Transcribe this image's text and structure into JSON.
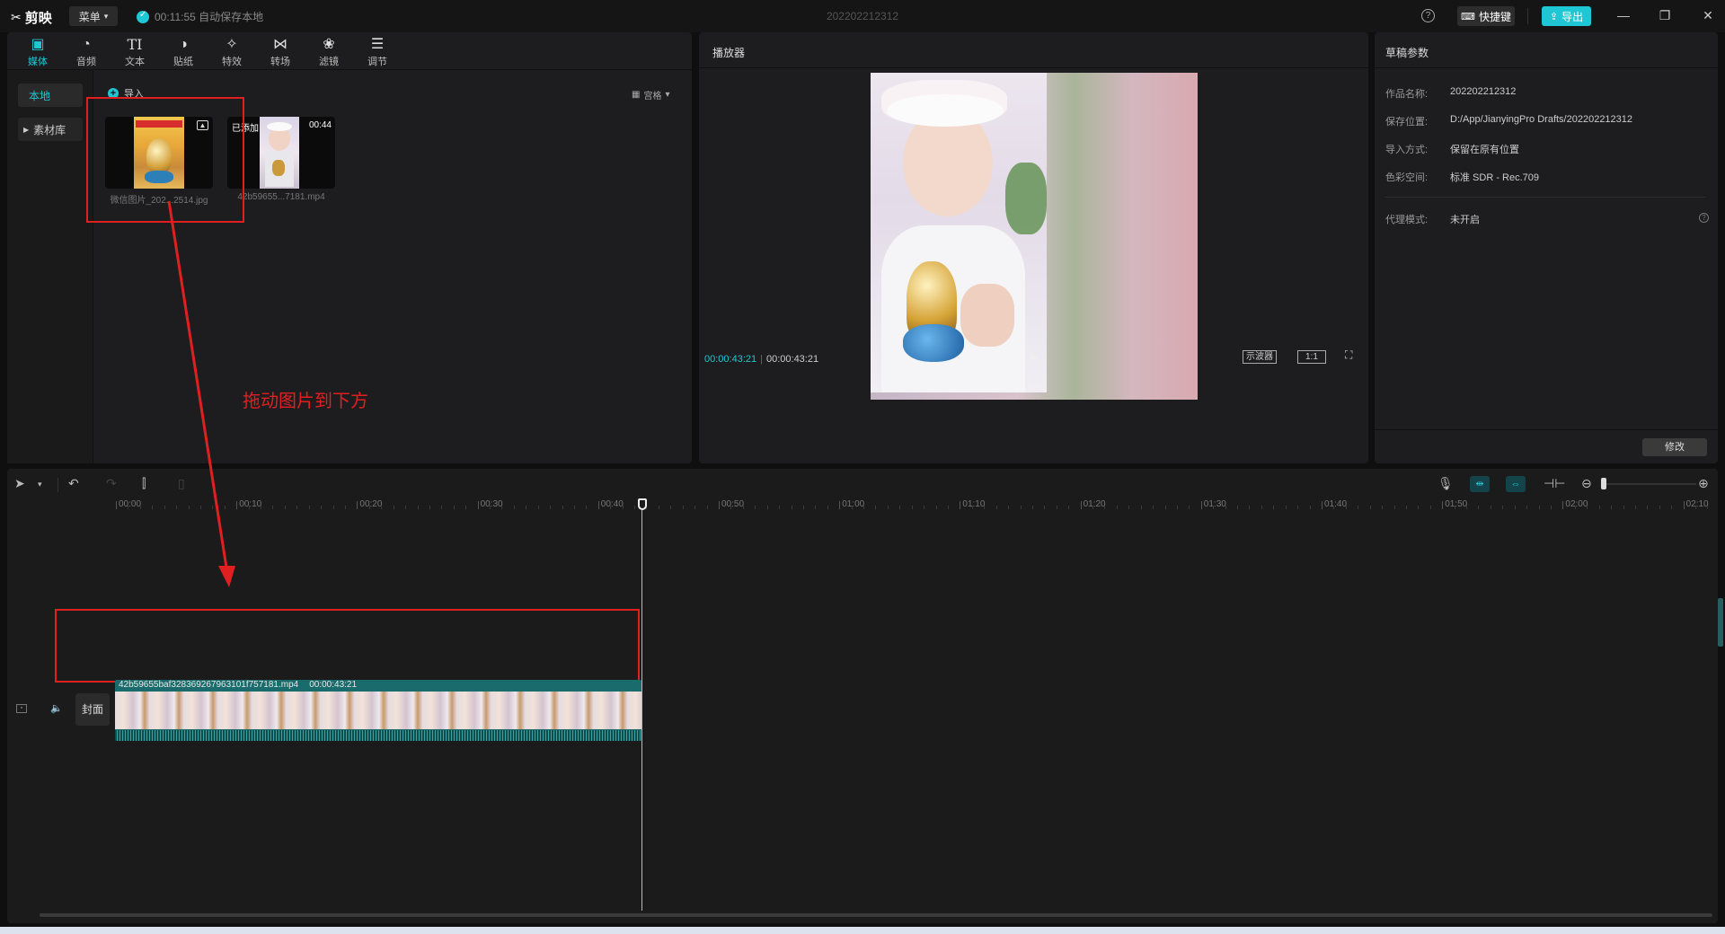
{
  "titlebar": {
    "app_name": "剪映",
    "menu_label": "菜单",
    "autosave": "00:11:55 自动保存本地",
    "doc_title": "202202212312",
    "shortcut_label": "快捷键",
    "export_label": "导出"
  },
  "media_toolbar": {
    "tools": [
      "媒体",
      "音频",
      "文本",
      "贴纸",
      "特效",
      "转场",
      "滤镜",
      "调节"
    ]
  },
  "media_panel": {
    "side_tabs": [
      "本地",
      "素材库"
    ],
    "import_label": "导入",
    "view_label": "宫格",
    "items": [
      {
        "caption": "微信图片_202...2514.jpg",
        "badge": ""
      },
      {
        "caption": "42b59655...7181.mp4",
        "badge": "已添加",
        "duration": "00:44"
      }
    ]
  },
  "annotation": {
    "text": "拖动图片到下方",
    "color": "#e02020"
  },
  "player": {
    "title": "播放器",
    "current_time": "00:00:43:21",
    "total_time": "00:00:43:21",
    "scope_label": "示波器",
    "ratio_label": "1:1"
  },
  "draft": {
    "title": "草稿参数",
    "fields": [
      {
        "label": "作品名称:",
        "value": "202202212312"
      },
      {
        "label": "保存位置:",
        "value": "D:/App/JianyingPro Drafts/202202212312"
      },
      {
        "label": "导入方式:",
        "value": "保留在原有位置"
      },
      {
        "label": "色彩空间:",
        "value": "标准 SDR - Rec.709"
      }
    ],
    "proxy_label": "代理模式:",
    "proxy_value": "未开启",
    "modify_label": "修改"
  },
  "timeline": {
    "ticks": [
      "00:00",
      "00:10",
      "00:20",
      "00:30",
      "00:40",
      "00:50",
      "01:00",
      "01:10",
      "01:20",
      "01:30",
      "01:40",
      "01:50",
      "02:00",
      "02:10"
    ],
    "cover_label": "封面",
    "clip_name": "42b59655baf328369267963101f757181.mp4",
    "clip_duration": "00:00:43:21"
  },
  "colors": {
    "accent": "#1fc7d4",
    "annotation": "#e02020",
    "panel": "#1d1d1f",
    "track": "#1a6b6b"
  }
}
